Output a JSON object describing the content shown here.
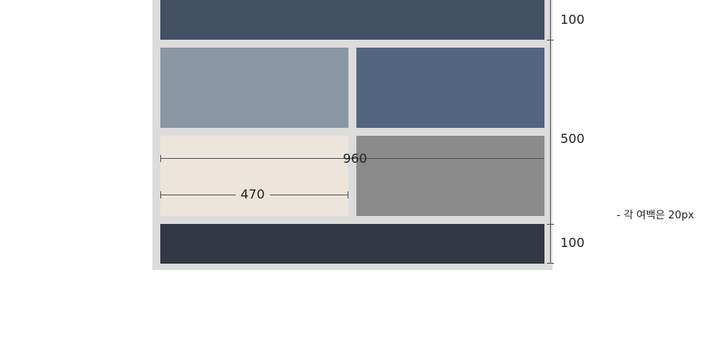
{
  "dimensions": {
    "total_width": "960",
    "column_width": "470",
    "header_height": "100",
    "content_height": "500",
    "footer_height": "100"
  },
  "note": "- 각 여백은 20px",
  "colors": {
    "background": "#ffffff",
    "gap": "#dcdcdc",
    "header": "#415065",
    "top_left": "#8a96a3",
    "top_right": "#53667f",
    "bottom_left": "#ede5dc",
    "bottom_right": "#8c8b8b",
    "footer": "#323944"
  }
}
